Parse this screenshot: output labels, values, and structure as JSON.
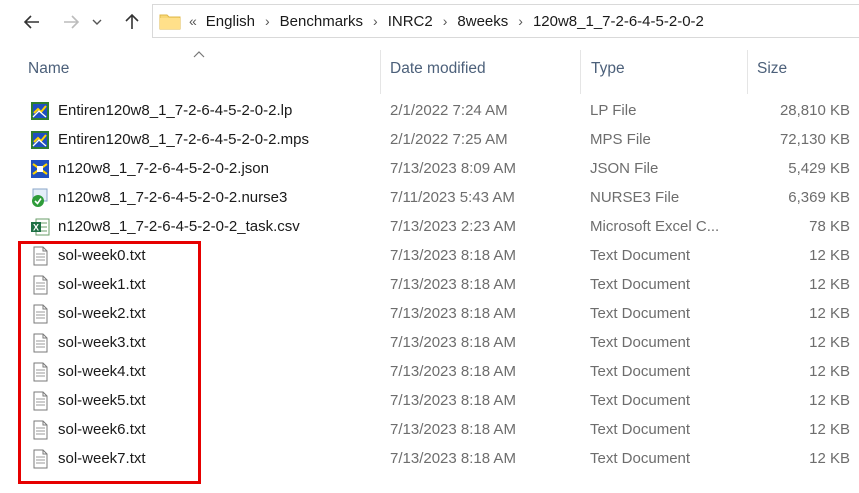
{
  "breadcrumb": {
    "lead": "«",
    "items": [
      "English",
      "Benchmarks",
      "INRC2",
      "8weeks",
      "120w8_1_7-2-6-4-5-2-0-2"
    ]
  },
  "columns": {
    "name": "Name",
    "date": "Date modified",
    "type": "Type",
    "size": "Size"
  },
  "files": [
    {
      "name": "Entiren120w8_1_7-2-6-4-5-2-0-2.lp",
      "date": "2/1/2022 7:24 AM",
      "type": "LP File",
      "size": "28,810 KB",
      "icon": "lp-file-icon"
    },
    {
      "name": "Entiren120w8_1_7-2-6-4-5-2-0-2.mps",
      "date": "2/1/2022 7:25 AM",
      "type": "MPS File",
      "size": "72,130 KB",
      "icon": "mps-file-icon"
    },
    {
      "name": "n120w8_1_7-2-6-4-5-2-0-2.json",
      "date": "7/13/2023 8:09 AM",
      "type": "JSON File",
      "size": "5,429 KB",
      "icon": "json-file-icon"
    },
    {
      "name": "n120w8_1_7-2-6-4-5-2-0-2.nurse3",
      "date": "7/11/2023 5:43 AM",
      "type": "NURSE3 File",
      "size": "6,369 KB",
      "icon": "nurse3-file-icon"
    },
    {
      "name": "n120w8_1_7-2-6-4-5-2-0-2_task.csv",
      "date": "7/13/2023 2:23 AM",
      "type": "Microsoft Excel C...",
      "size": "78 KB",
      "icon": "excel-csv-icon"
    },
    {
      "name": "sol-week0.txt",
      "date": "7/13/2023 8:18 AM",
      "type": "Text Document",
      "size": "12 KB",
      "icon": "text-file-icon"
    },
    {
      "name": "sol-week1.txt",
      "date": "7/13/2023 8:18 AM",
      "type": "Text Document",
      "size": "12 KB",
      "icon": "text-file-icon"
    },
    {
      "name": "sol-week2.txt",
      "date": "7/13/2023 8:18 AM",
      "type": "Text Document",
      "size": "12 KB",
      "icon": "text-file-icon"
    },
    {
      "name": "sol-week3.txt",
      "date": "7/13/2023 8:18 AM",
      "type": "Text Document",
      "size": "12 KB",
      "icon": "text-file-icon"
    },
    {
      "name": "sol-week4.txt",
      "date": "7/13/2023 8:18 AM",
      "type": "Text Document",
      "size": "12 KB",
      "icon": "text-file-icon"
    },
    {
      "name": "sol-week5.txt",
      "date": "7/13/2023 8:18 AM",
      "type": "Text Document",
      "size": "12 KB",
      "icon": "text-file-icon"
    },
    {
      "name": "sol-week6.txt",
      "date": "7/13/2023 8:18 AM",
      "type": "Text Document",
      "size": "12 KB",
      "icon": "text-file-icon"
    },
    {
      "name": "sol-week7.txt",
      "date": "7/13/2023 8:18 AM",
      "type": "Text Document",
      "size": "12 KB",
      "icon": "text-file-icon"
    }
  ],
  "colors": {
    "highlight": "#e60000",
    "header_text": "#4c607a",
    "secondary_text": "#6d6d6d"
  }
}
